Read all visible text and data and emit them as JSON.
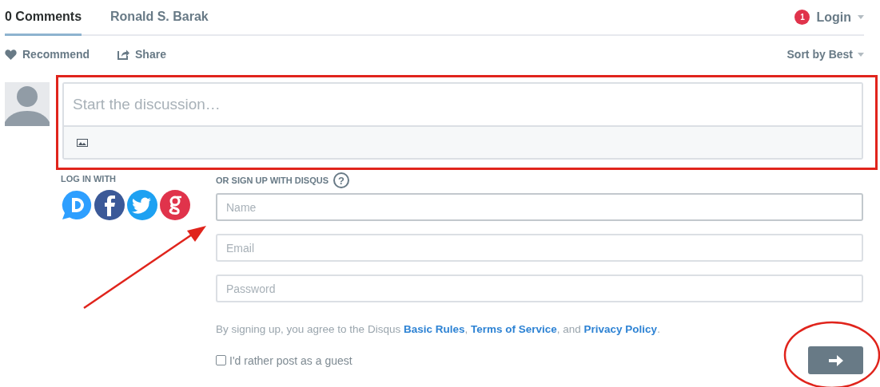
{
  "tabs": [
    {
      "label": "0 Comments",
      "selected": true
    },
    {
      "label": "Ronald S. Barak",
      "selected": false
    }
  ],
  "login": {
    "badge": "1",
    "label": "Login"
  },
  "actions": {
    "recommend": "Recommend",
    "share": "Share",
    "sort": "Sort by Best"
  },
  "composer": {
    "placeholder": "Start the discussion…"
  },
  "login_with": {
    "label": "LOG IN WITH",
    "services": [
      {
        "kind": "d"
      },
      {
        "kind": "f"
      },
      {
        "kind": "bird"
      },
      {
        "kind": "g"
      }
    ]
  },
  "signup": {
    "label": "OR SIGN UP WITH DISQUS",
    "help": "?",
    "fields": [
      {
        "placeholder": "Name",
        "focused": true
      },
      {
        "placeholder": "Email",
        "focused": false
      },
      {
        "placeholder": "Password",
        "focused": false
      }
    ],
    "agreement": [
      {
        "text": "By signing up, you agree to the Disqus ",
        "link": false
      },
      {
        "text": "Basic Rules",
        "link": true
      },
      {
        "text": ", ",
        "link": false
      },
      {
        "text": "Terms of Service",
        "link": true
      },
      {
        "text": ", and ",
        "link": false
      },
      {
        "text": "Privacy Policy",
        "link": true
      },
      {
        "text": ".",
        "link": false
      }
    ],
    "guest": {
      "label": "I'd rather post as a guest",
      "checked": false
    }
  },
  "annotations": [
    {
      "kind": "rectangle"
    },
    {
      "kind": "arrow"
    },
    {
      "kind": "ellipse"
    }
  ]
}
